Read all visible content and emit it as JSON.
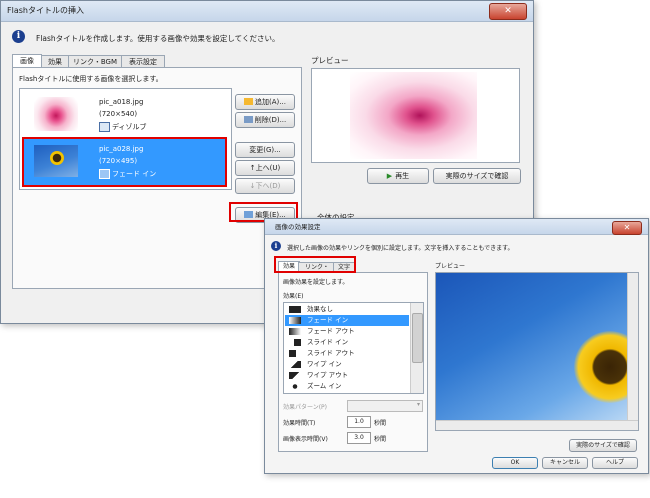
{
  "main_dialog": {
    "title": "Flashタイトルの挿入",
    "info_text": "Flashタイトルを作成します。使用する画像や効果を設定してください。",
    "tabs": [
      {
        "label": "画像",
        "active": true
      },
      {
        "label": "効果",
        "active": false
      },
      {
        "label": "リンク・BGM",
        "active": false
      },
      {
        "label": "表示設定",
        "active": false
      }
    ],
    "image_section_label": "Flashタイトルに使用する画像を選択します。",
    "images": [
      {
        "name": "pic_a018.jpg",
        "size": "(720×540)",
        "effect": "ディゾルブ",
        "selected": false
      },
      {
        "name": "pic_a028.jpg",
        "size": "(720×495)",
        "effect": "フェード イン",
        "selected": true
      }
    ],
    "buttons": {
      "add": "追加(A)...",
      "delete": "削除(D)...",
      "change": "変更(G)...",
      "up": "↑上へ(U)",
      "down": "↓下へ(D)",
      "edit": "編集(E)...",
      "play": "再生",
      "actual_size": "実際のサイズで確認"
    },
    "preview_label": "プレビュー",
    "overall_setting_label": "全体の設定"
  },
  "effect_dialog": {
    "title": "画像の効果設定",
    "info_text": "選択した画像の効果やリンクを個別に設定します。文字を挿入することもできます。",
    "tabs": [
      {
        "label": "効果",
        "active": true
      },
      {
        "label": "リンク・BGM",
        "active": false
      },
      {
        "label": "文字",
        "active": false
      }
    ],
    "section_label": "画像効果を設定します。",
    "effect_list_label": "効果(E)",
    "effects": [
      {
        "label": "効果なし",
        "selected": false
      },
      {
        "label": "フェード イン",
        "selected": true
      },
      {
        "label": "フェード アウト",
        "selected": false
      },
      {
        "label": "スライド イン",
        "selected": false
      },
      {
        "label": "スライド アウト",
        "selected": false
      },
      {
        "label": "ワイプ イン",
        "selected": false
      },
      {
        "label": "ワイプ アウト",
        "selected": false
      },
      {
        "label": "ズーム イン",
        "selected": false
      }
    ],
    "effect_pattern_label": "効果パターン(P)",
    "effect_time_label": "効果時間(T)",
    "effect_time_value": "1.0",
    "display_time_label": "画像表示時間(V)",
    "display_time_value": "3.0",
    "seconds_unit": "秒間",
    "preview_label": "プレビュー",
    "buttons": {
      "actual_size": "実際のサイズで確認",
      "ok": "OK",
      "cancel": "キャンセル",
      "help": "ヘルプ"
    }
  },
  "colors": {
    "highlight": "#e00000",
    "selection": "#3399ff",
    "title_gradient_top": "#dfe9f5"
  }
}
